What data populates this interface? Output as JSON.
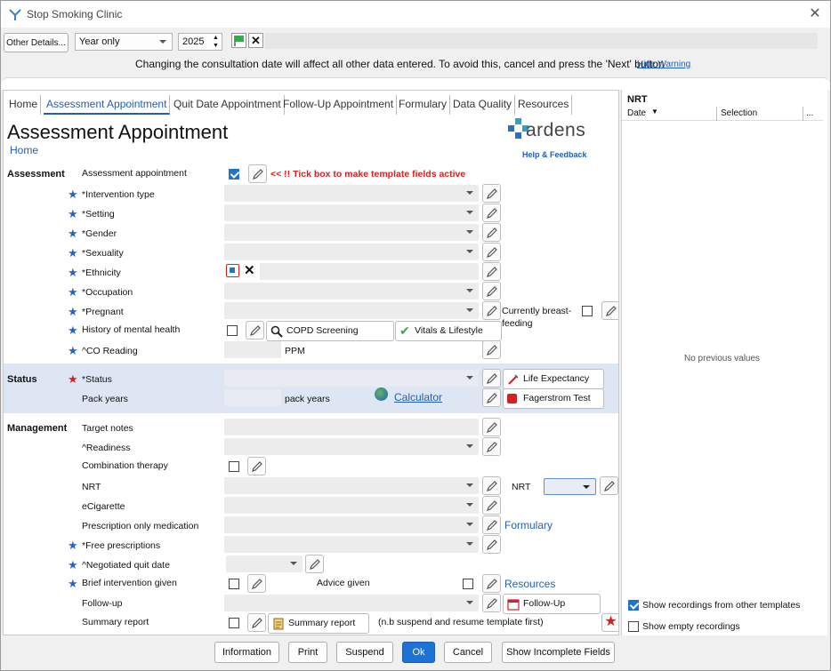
{
  "window": {
    "title": "Stop Smoking Clinic"
  },
  "toolbar": {
    "other_details": "Other Details...",
    "period": "Year only",
    "year": "2025"
  },
  "warning": {
    "text": "Changing the consultation date will affect all other data entered. To avoid this, cancel and press the 'Next' button",
    "hide_link": "Hide Warning"
  },
  "tabs": [
    {
      "label": "Home"
    },
    {
      "label": "Assessment Appointment"
    },
    {
      "label": "Quit Date Appointment"
    },
    {
      "label": "Follow-Up Appointment"
    },
    {
      "label": "Formulary"
    },
    {
      "label": "Data Quality"
    },
    {
      "label": "Resources"
    }
  ],
  "page": {
    "title": "Assessment Appointment",
    "home_link": "Home"
  },
  "logo": {
    "name": "ardens",
    "help": "Help & Feedback"
  },
  "sections": {
    "assessment": "Assessment",
    "status": "Status",
    "management": "Management"
  },
  "assessment": {
    "appt_label": "Assessment appointment",
    "tick_note": "<< !! Tick box to make template fields active",
    "intervention": "*Intervention type",
    "setting": "*Setting",
    "gender": "*Gender",
    "sexuality": "*Sexuality",
    "ethnicity": "*Ethnicity",
    "occupation": "*Occupation",
    "pregnant": "*Pregnant",
    "breastfeeding": "Currently breast-feeding",
    "mental_health": "History of mental health",
    "copd": "COPD Screening",
    "vitals": "Vitals & Lifestyle",
    "co_reading": "^CO Reading",
    "ppm": "PPM"
  },
  "status": {
    "status_label": "*Status",
    "life_expectancy": "Life Expectancy",
    "pack_years_label": "Pack years",
    "pack_years_unit": "pack years",
    "calculator": "Calculator",
    "fagerstrom": "Fagerstrom Test"
  },
  "management": {
    "target_notes": "Target notes",
    "readiness": "^Readiness",
    "combination": "Combination therapy",
    "nrt": "NRT",
    "nrt_right": "NRT",
    "ecig": "eCigarette",
    "pom": "Prescription only medication",
    "formulary": "Formulary",
    "free_rx": "*Free prescriptions",
    "quit_date": "^Negotiated quit date",
    "brief": "Brief intervention given",
    "advice": "Advice given",
    "resources": "Resources",
    "follow_up": "Follow-up",
    "follow_up_btn": "Follow-Up",
    "summary": "Summary report",
    "summary_btn": "Summary report",
    "summary_note": "(n.b suspend and resume template first)"
  },
  "right_panel": {
    "title": "NRT",
    "col_date": "Date",
    "col_selection": "Selection",
    "col_more": "...",
    "empty": "No previous values",
    "show_other": "Show recordings from other templates",
    "show_empty": "Show empty recordings"
  },
  "buttons": {
    "information": "Information",
    "print": "Print",
    "suspend": "Suspend",
    "ok": "Ok",
    "cancel": "Cancel",
    "incomplete": "Show Incomplete Fields"
  },
  "colors": {
    "accent": "#1f5fb8",
    "warning_red": "#d32222",
    "status_band": "#dde6f2"
  }
}
